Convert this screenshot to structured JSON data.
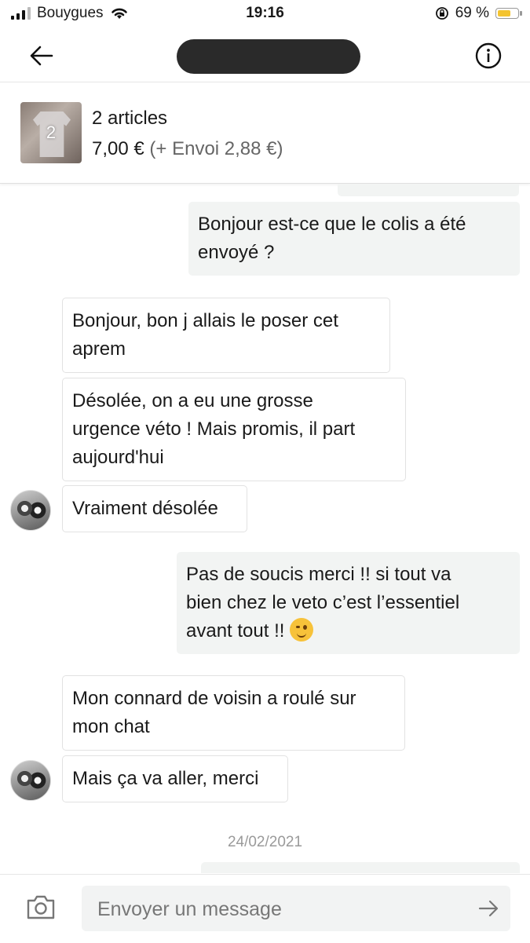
{
  "status_bar": {
    "carrier": "Bouygues",
    "time": "19:16",
    "battery_text": "69 %",
    "battery_level": 0.69,
    "battery_color": "#f4c430"
  },
  "nav": {
    "back_icon": "arrow-left-icon",
    "info_icon": "info-circle-icon"
  },
  "item": {
    "thumb_count": "2",
    "title": "2 articles",
    "price": "7,00 €",
    "shipping": "(+ Envoi 2,88 €)"
  },
  "chat": {
    "messages": [
      {
        "side": "out",
        "lines": [
          "Bonjour est-ce que le colis a été",
          "envoyé ?"
        ]
      },
      {
        "side": "in",
        "lines": [
          "Bonjour,  bon j allais le poser cet",
          "aprem"
        ]
      },
      {
        "side": "in",
        "lines": [
          "Désolée,  on a eu une grosse",
          "urgence véto ! Mais promis, il part",
          "aujourd'hui"
        ]
      },
      {
        "side": "in",
        "lines": [
          "Vraiment désolée"
        ]
      },
      {
        "side": "out",
        "lines": [
          "Pas de soucis merci !! si tout va",
          "bien chez le veto c’est l’essentiel",
          "avant tout !!"
        ],
        "emoji": "winking-face-emoji"
      },
      {
        "side": "in",
        "lines": [
          "Mon connard de voisin a roulé sur",
          "mon chat"
        ]
      },
      {
        "side": "in",
        "lines": [
          "Mais ça va aller, merci"
        ]
      }
    ],
    "date_separator": "24/02/2021"
  },
  "composer": {
    "placeholder": "Envoyer un message",
    "camera_icon": "camera-icon",
    "send_icon": "send-arrow-icon"
  }
}
